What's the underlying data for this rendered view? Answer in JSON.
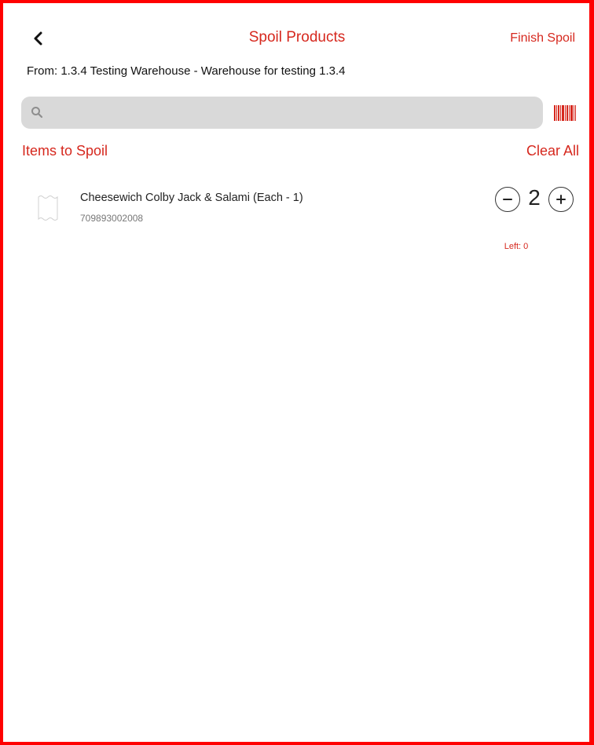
{
  "header": {
    "title": "Spoil Products",
    "finish_label": "Finish Spoil",
    "from_text": "From: 1.3.4 Testing Warehouse - Warehouse for testing 1.3.4"
  },
  "search": {
    "value": "",
    "placeholder": ""
  },
  "section": {
    "title": "Items to Spoil",
    "clear_all_label": "Clear All"
  },
  "items": [
    {
      "name": "Cheesewich Colby Jack & Salami (Each - 1)",
      "sku": "709893002008",
      "quantity": "2",
      "left_text": "Left: 0"
    }
  ],
  "icons": {
    "back": "chevron-left-icon",
    "search": "search-icon",
    "barcode": "barcode-icon",
    "minus": "minus-circle-icon",
    "plus": "plus-circle-icon",
    "thumbnail": "product-placeholder-icon"
  },
  "colors": {
    "accent": "#d6281e",
    "search_bg": "#d9d9d9",
    "frame": "#ff0000"
  }
}
